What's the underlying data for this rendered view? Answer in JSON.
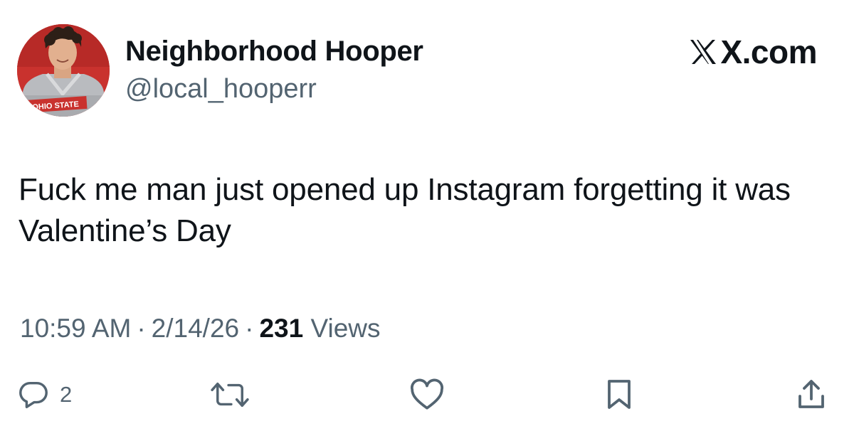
{
  "post": {
    "author": {
      "display_name": "Neighborhood Hooper",
      "handle": "@local_hooperr",
      "avatar_badge": "OHIO STATE"
    },
    "brand": "X.com",
    "text": "Fuck me man just opened up Instagram forgetting it was Valentine’s Day",
    "time": "10:59 AM",
    "separator": "·",
    "date": "2/14/26",
    "views_count": "231",
    "views_label": "Views"
  },
  "actions": {
    "reply": {
      "icon": "reply-icon",
      "count": "2"
    },
    "repost": {
      "icon": "repost-icon"
    },
    "like": {
      "icon": "heart-icon"
    },
    "bookmark": {
      "icon": "bookmark-icon"
    },
    "share": {
      "icon": "share-icon"
    }
  },
  "colors": {
    "text_primary": "#0f1419",
    "text_secondary": "#536471",
    "icon": "#536471",
    "avatar_background": "#c9322e"
  }
}
